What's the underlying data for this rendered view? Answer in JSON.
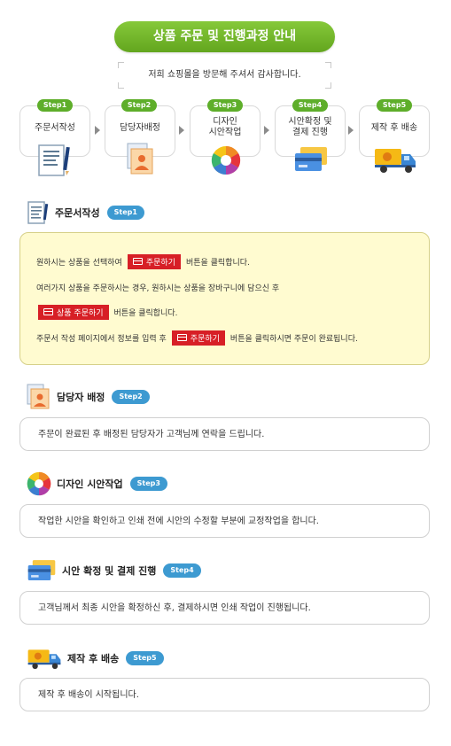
{
  "header": {
    "title": "상품 주문 및 진행과정 안내",
    "subtitle": "저희 쇼핑몰을 방문해 주셔서 감사합니다."
  },
  "steps": [
    {
      "badge": "Step1",
      "label": "주문서작성",
      "icon": "order-form-icon"
    },
    {
      "badge": "Step2",
      "label": "담당자배정",
      "icon": "manager-icon"
    },
    {
      "badge": "Step3",
      "label_line1": "디자인",
      "label_line2": "시안작업",
      "icon": "color-wheel-icon"
    },
    {
      "badge": "Step4",
      "label_line1": "시안확정 및",
      "label_line2": "결제 진행",
      "icon": "payment-card-icon"
    },
    {
      "badge": "Step5",
      "label": "제작 후 배송",
      "icon": "delivery-truck-icon"
    }
  ],
  "sections": {
    "s1": {
      "title": "주문서작성",
      "badge": "Step1",
      "line1_before": "원하시는 상품을 선택하여",
      "btn_order": "주문하기",
      "line1_after": "버튼을 클릭합니다.",
      "line2": "여러가지 상품을 주문하시는 경우, 원하시는 상품을 장바구니에 담으신 후",
      "btn_product_order": "상품 주문하기",
      "line3_after": "버튼을 클릭합니다.",
      "line4_before": "주문서 작성 페이지에서 정보를 입력 후",
      "line4_after": "버튼을 클릭하시면 주문이 완료됩니다."
    },
    "s2": {
      "title": "담당자 배정",
      "badge": "Step2",
      "text": "주문이 완료된 후 배정된 담당자가 고객님께 연락을 드립니다."
    },
    "s3": {
      "title": "디자인 시안작업",
      "badge": "Step3",
      "text": "작업한 시안을 확인하고 인쇄 전에 시안의 수정할 부분에 교정작업을 합니다."
    },
    "s4": {
      "title": "시안 확정 및 결제 진행",
      "badge": "Step4",
      "text": "고객님께서 최종 시안을 확정하신 후, 결제하시면 인쇄 작업이 진행됩니다."
    },
    "s5": {
      "title": "제작 후 배송",
      "badge": "Step5",
      "text": "제작 후 배송이 시작됩니다."
    }
  },
  "colors": {
    "green": "#63a61e",
    "blue_badge": "#3d9ad1",
    "red_button": "#d71f26",
    "yellow_box": "#fffbd0"
  }
}
